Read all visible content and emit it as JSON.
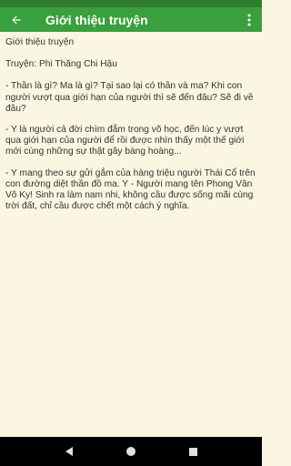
{
  "header": {
    "title": "Giới thiệu truyện",
    "back_icon": "arrow-left-icon",
    "menu_icon": "more-vert-icon"
  },
  "content": {
    "heading": "Giới thiệu truyện",
    "story_line": "Truyện: Phi Thăng Chi Hậu",
    "paragraphs": [
      "- Thần là gì? Ma là gì? Tại sao lại có thần và ma? Khi con người vượt qua giới hạn của người thì sẽ đến đâu? Sẽ đi về đâu?",
      "- Y là người cả đời chìm đắm trong võ học, đến lúc y vượt qua giới hạn của người để rồi được nhìn thấy một thế giới mới cùng những sự thật gây bàng hoàng...",
      "- Y mang theo sự gửi gắm của hàng triệu người Thái Cổ trên con đường diệt thần đồ ma. Y - Người mang tên Phong Vân Vô Ky! Sinh ra làm nam nhi, không cầu được sống mãi cùng trời đất, chỉ cầu được chết một cách ý nghĩa."
    ]
  },
  "colors": {
    "app_bar": "#3a9f3e",
    "status_bar": "#2e7d32",
    "background": "#fbf6e1",
    "text": "#333333"
  },
  "nav": {
    "back_icon": "nav-back-triangle-icon",
    "home_icon": "nav-home-circle-icon",
    "recents_icon": "nav-recents-square-icon"
  }
}
